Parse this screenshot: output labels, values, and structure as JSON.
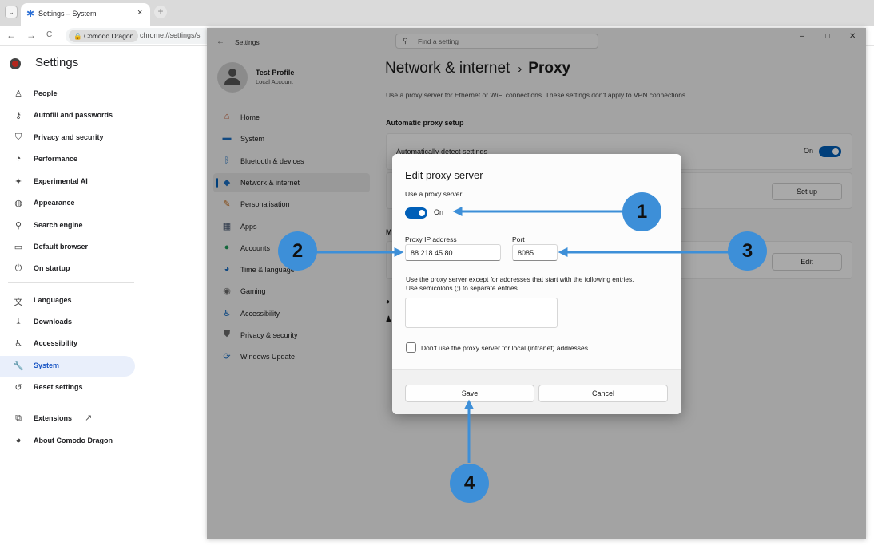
{
  "browser": {
    "tab_title": "Settings – System",
    "tab_close": "×",
    "tab_dropdown": "⌄",
    "new_tab": "+",
    "back": "←",
    "forward": "→",
    "reload": "C",
    "site_chip": "Comodo Dragon",
    "url": "chrome://settings/s"
  },
  "chrome_settings": {
    "title": "Settings",
    "items": [
      {
        "label": "People",
        "icon": "person-icon",
        "glyph": "♙"
      },
      {
        "label": "Autofill and passwords",
        "icon": "key-icon",
        "glyph": "⚷"
      },
      {
        "label": "Privacy and security",
        "icon": "shield-icon",
        "glyph": "⛉"
      },
      {
        "label": "Performance",
        "icon": "gauge-icon",
        "glyph": "◔"
      },
      {
        "label": "Experimental AI",
        "icon": "sparkle-icon",
        "glyph": "✦"
      },
      {
        "label": "Appearance",
        "icon": "palette-icon",
        "glyph": "◍"
      },
      {
        "label": "Search engine",
        "icon": "search-icon",
        "glyph": "⚲"
      },
      {
        "label": "Default browser",
        "icon": "browser-window-icon",
        "glyph": "▭"
      },
      {
        "label": "On startup",
        "icon": "power-icon",
        "glyph": "⏻"
      },
      {
        "label": "Languages",
        "icon": "translate-icon",
        "glyph": "文"
      },
      {
        "label": "Downloads",
        "icon": "download-icon",
        "glyph": "⤓"
      },
      {
        "label": "Accessibility",
        "icon": "accessibility-icon",
        "glyph": "♿"
      },
      {
        "label": "System",
        "icon": "wrench-icon",
        "glyph": "🔧"
      },
      {
        "label": "Reset settings",
        "icon": "reset-icon",
        "glyph": "↺"
      },
      {
        "label": "Extensions",
        "icon": "puzzle-icon",
        "glyph": "⧉"
      },
      {
        "label": "About Comodo Dragon",
        "icon": "dragon-logo-icon",
        "glyph": "◕"
      }
    ],
    "active_index": 12,
    "external_link_glyph": "↗"
  },
  "win_settings": {
    "window_title": "Settings",
    "search_placeholder": "Find a setting",
    "controls": {
      "minimize": "–",
      "maximize": "□",
      "close": "✕"
    },
    "profile": {
      "name": "Test Profile",
      "account": "Local Account"
    },
    "nav": [
      {
        "label": "Home",
        "icon": "home-icon",
        "glyph": "⌂",
        "color": "#c2562e"
      },
      {
        "label": "System",
        "icon": "monitor-icon",
        "glyph": "▬",
        "color": "#1b6fc2"
      },
      {
        "label": "Bluetooth & devices",
        "icon": "bluetooth-icon",
        "glyph": "ᛒ",
        "color": "#1b6fc2"
      },
      {
        "label": "Network & internet",
        "icon": "wifi-icon",
        "glyph": "◆",
        "color": "#1b6fc2"
      },
      {
        "label": "Personalisation",
        "icon": "brush-icon",
        "glyph": "✎",
        "color": "#c46a16"
      },
      {
        "label": "Apps",
        "icon": "apps-icon",
        "glyph": "▦",
        "color": "#4a5a73"
      },
      {
        "label": "Accounts",
        "icon": "accounts-icon",
        "glyph": "●",
        "color": "#1f9c5a"
      },
      {
        "label": "Time & language",
        "icon": "globe-clock-icon",
        "glyph": "◕",
        "color": "#1b6fc2"
      },
      {
        "label": "Gaming",
        "icon": "gamepad-icon",
        "glyph": "◉",
        "color": "#6b6b6b"
      },
      {
        "label": "Accessibility",
        "icon": "accessibility-icon",
        "glyph": "♿",
        "color": "#1b6fc2"
      },
      {
        "label": "Privacy & security",
        "icon": "shield-icon",
        "glyph": "⛊",
        "color": "#6b6b6b"
      },
      {
        "label": "Windows Update",
        "icon": "update-icon",
        "glyph": "⟳",
        "color": "#1b6fc2"
      }
    ],
    "active_nav": 3,
    "breadcrumb_parent": "Network & internet",
    "breadcrumb_sep": "›",
    "breadcrumb_current": "Proxy",
    "description": "Use a proxy server for Ethernet or WiFi connections. These settings don't apply to VPN connections.",
    "auto_section": "Automatic proxy setup",
    "auto_detect_label": "Automatically detect settings",
    "auto_detect_state": "On",
    "setup_button": "Set up",
    "edit_button": "Edit",
    "manual_section_partial": "M"
  },
  "dialog": {
    "title": "Edit proxy server",
    "use_proxy_label": "Use a proxy server",
    "use_proxy_state": "On",
    "ip_label": "Proxy IP address",
    "ip_value": "88.218.45.80",
    "port_label": "Port",
    "port_value": "8085",
    "exceptions_line1": "Use the proxy server except for addresses that start with the following entries.",
    "exceptions_line2": "Use semicolons (;) to separate entries.",
    "exceptions_value": "",
    "local_bypass_label": "Don't use the proxy server for local (intranet) addresses",
    "save_button": "Save",
    "cancel_button": "Cancel"
  },
  "annotations": {
    "callouts": [
      "1",
      "2",
      "3",
      "4"
    ],
    "color": "#3d8fd8"
  },
  "colors": {
    "accent": "#005fb8",
    "chrome_active": "#1a56c4",
    "annotation": "#3d8fd8"
  }
}
